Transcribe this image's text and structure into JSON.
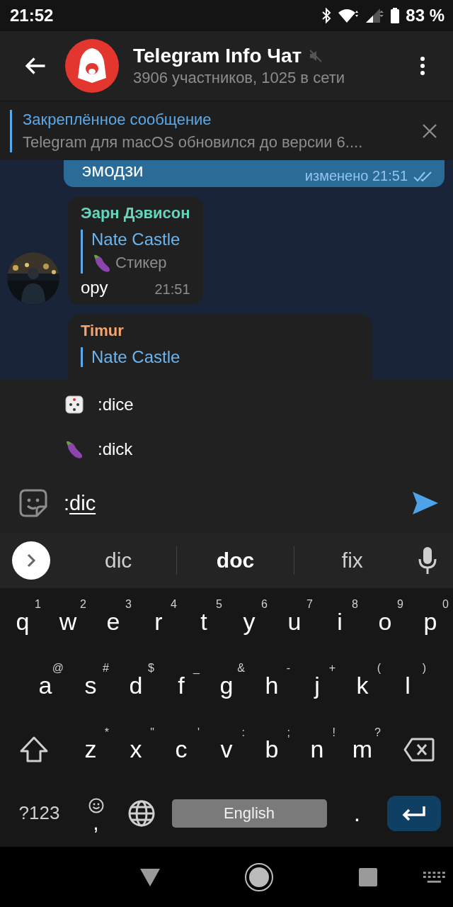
{
  "status_bar": {
    "time": "21:52",
    "battery": "83 %"
  },
  "header": {
    "title": "Telegram Info Чат",
    "muted": true,
    "subtitle": "3906 участников, 1025 в сети"
  },
  "pinned": {
    "label": "Закреплённое сообщение",
    "text": "Telegram для macOS обновился до версии 6...."
  },
  "messages": [
    {
      "kind": "outgoing",
      "text": "эмодзи",
      "edited": "изменено 21:51",
      "read": true
    },
    {
      "kind": "incoming",
      "sender": "Эарн Дэвисон",
      "color": "#5fd7bf",
      "avatar": true,
      "reply": {
        "name": "Nate Castle",
        "kind": "sticker",
        "text": "Стикер"
      },
      "text": "ору",
      "time": "21:51"
    },
    {
      "kind": "incoming",
      "sender": "Timur",
      "color": "#f5a46e",
      "avatar": false,
      "reply": {
        "name": "Nate Castle"
      }
    }
  ],
  "suggestions": [
    {
      "kind": "dice",
      "text": ":dice"
    },
    {
      "kind": "eggplant",
      "text": ":dick"
    }
  ],
  "composer": {
    "text": ":",
    "composing_text": "dic"
  },
  "keyboard": {
    "word_suggestions": [
      {
        "text": "dic",
        "selected": false
      },
      {
        "text": "doc",
        "selected": true
      },
      {
        "text": "fix",
        "selected": false
      }
    ],
    "rows": [
      {
        "keys": [
          {
            "label": "q",
            "hint": "1"
          },
          {
            "label": "w",
            "hint": "2"
          },
          {
            "label": "e",
            "hint": "3"
          },
          {
            "label": "r",
            "hint": "4"
          },
          {
            "label": "t",
            "hint": "5"
          },
          {
            "label": "y",
            "hint": "6"
          },
          {
            "label": "u",
            "hint": "7"
          },
          {
            "label": "i",
            "hint": "8"
          },
          {
            "label": "o",
            "hint": "9"
          },
          {
            "label": "p",
            "hint": "0"
          }
        ]
      },
      {
        "keys": [
          {
            "label": "a",
            "hint": "@"
          },
          {
            "label": "s",
            "hint": "#"
          },
          {
            "label": "d",
            "hint": "$"
          },
          {
            "label": "f",
            "hint": "_"
          },
          {
            "label": "g",
            "hint": "&"
          },
          {
            "label": "h",
            "hint": "-"
          },
          {
            "label": "j",
            "hint": "+"
          },
          {
            "label": "k",
            "hint": "("
          },
          {
            "label": "l",
            "hint": ")"
          }
        ]
      },
      {
        "keys": [
          {
            "kind": "shift"
          },
          {
            "label": "z",
            "hint": "*"
          },
          {
            "label": "x",
            "hint": "\""
          },
          {
            "label": "c",
            "hint": "'"
          },
          {
            "label": "v",
            "hint": ":"
          },
          {
            "label": "b",
            "hint": ";"
          },
          {
            "label": "n",
            "hint": "!"
          },
          {
            "label": "m",
            "hint": "?"
          },
          {
            "kind": "backspace"
          }
        ]
      },
      {
        "keys": [
          {
            "kind": "symbols",
            "label": "?123"
          },
          {
            "kind": "emoji",
            "label": ","
          },
          {
            "kind": "globe"
          },
          {
            "kind": "space",
            "label": "English"
          },
          {
            "label": "."
          },
          {
            "kind": "enter"
          }
        ]
      }
    ]
  }
}
